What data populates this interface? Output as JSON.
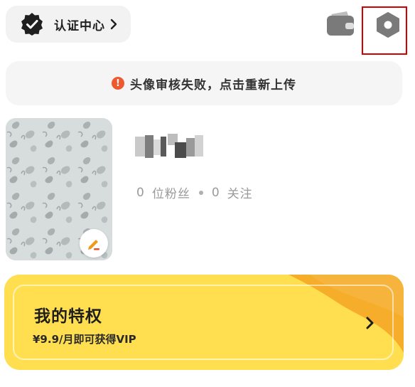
{
  "header": {
    "verify_label": "认证中心",
    "icons": [
      "verified-badge-icon",
      "chevron-right-icon",
      "wallet-icon",
      "settings-icon"
    ]
  },
  "banner": {
    "icon": "!",
    "text": "头像审核失败，点击重新上传"
  },
  "profile": {
    "username": "",
    "followers_count": "0",
    "followers_label": "位粉丝",
    "following_count": "0",
    "following_label": "关注"
  },
  "vip": {
    "title": "我的特权",
    "subtitle": "¥9.9/月即可获得VIP"
  },
  "colors": {
    "accent_yellow": "#ffdf4f",
    "accent_orange": "#f5a623",
    "warning": "#ee5a2e",
    "highlight_box": "#d40000"
  }
}
